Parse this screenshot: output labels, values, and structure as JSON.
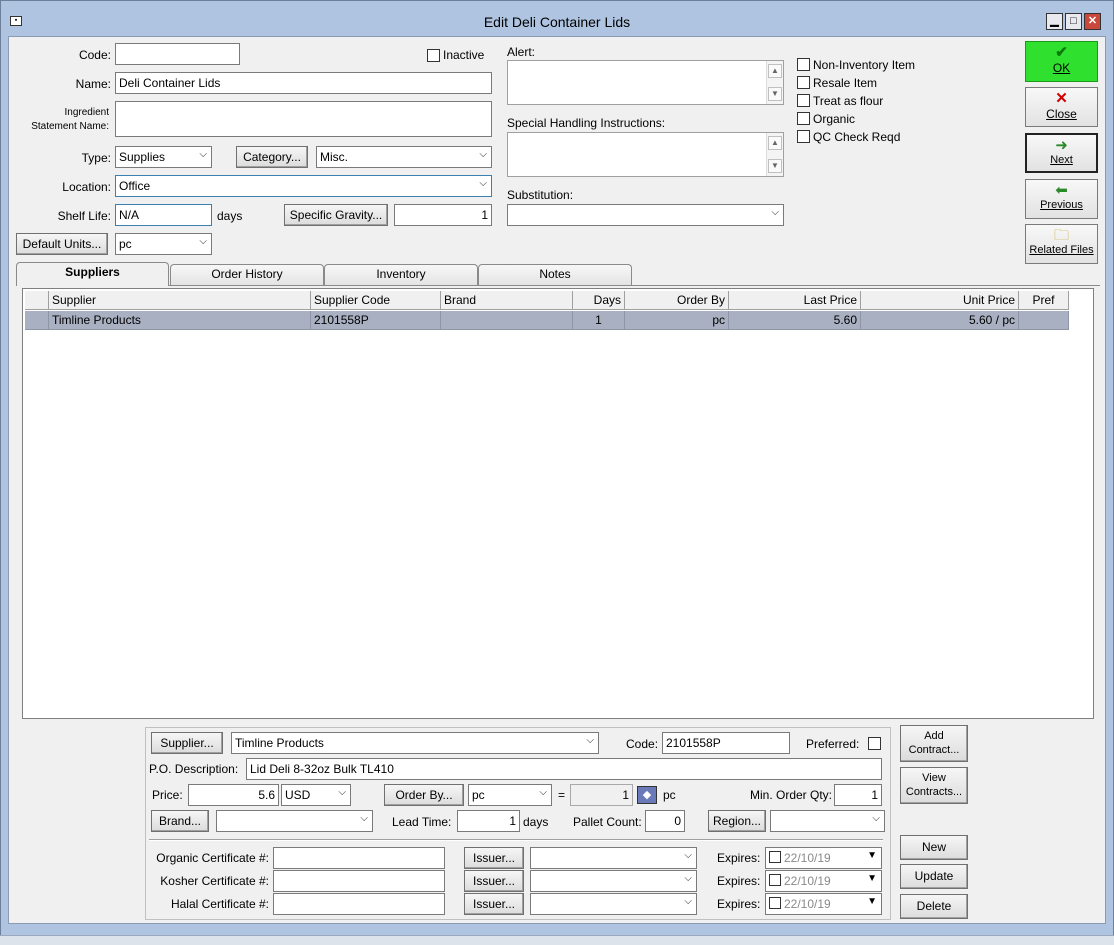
{
  "window": {
    "title": "Edit Deli Container Lids"
  },
  "form": {
    "code_label": "Code:",
    "code_value": "",
    "inactive_label": "Inactive",
    "name_label": "Name:",
    "name_value": "Deli Container Lids",
    "ingredient_label_1": "Ingredient",
    "ingredient_label_2": "Statement Name:",
    "ingredient_value": "",
    "type_label": "Type:",
    "type_value": "Supplies",
    "category_button": "Category...",
    "category_value": "Misc.",
    "location_label": "Location:",
    "location_value": "Office",
    "shelf_life_label": "Shelf Life:",
    "shelf_life_value": "N/A",
    "days_label": "days",
    "specific_gravity_button": "Specific Gravity...",
    "specific_gravity_value": "1",
    "default_units_button": "Default Units...",
    "default_units_value": "pc",
    "alert_label": "Alert:",
    "special_handling_label": "Special Handling Instructions:",
    "substitution_label": "Substitution:",
    "substitution_value": ""
  },
  "options": {
    "non_inventory": "Non-Inventory Item",
    "resale": "Resale Item",
    "treat_as_flour": "Treat as flour",
    "organic": "Organic",
    "qc_check": "QC Check Reqd"
  },
  "actions": {
    "ok": "OK",
    "close": "Close",
    "next": "Next",
    "previous": "Previous",
    "related_files": "Related Files"
  },
  "tabs": [
    "Suppliers",
    "Order History",
    "Inventory",
    "Notes"
  ],
  "grid": {
    "headers": [
      "Supplier",
      "Supplier Code",
      "Brand",
      "Days",
      "Order By",
      "Last Price",
      "Unit Price",
      "Pref"
    ],
    "rows": [
      {
        "supplier": "Timline Products",
        "code": "2101558P",
        "brand": "",
        "days": "1",
        "order_by": "pc",
        "last_price": "5.60",
        "unit_price": "5.60 / pc",
        "pref": ""
      }
    ]
  },
  "detail": {
    "supplier_button": "Supplier...",
    "supplier_value": "Timline Products",
    "code_label": "Code:",
    "code_value": "2101558P",
    "preferred_label": "Preferred:",
    "po_desc_label": "P.O. Description:",
    "po_desc_value": "Lid Deli 8-32oz Bulk TL410",
    "price_label": "Price:",
    "price_value": "5.6",
    "currency_value": "USD",
    "order_by_button": "Order By...",
    "order_by_value": "pc",
    "equals": "=",
    "qty_value": "1",
    "qty_unit": "pc",
    "min_order_label": "Min. Order Qty:",
    "min_order_value": "1",
    "brand_button": "Brand...",
    "brand_value": "",
    "lead_time_label": "Lead Time:",
    "lead_time_value": "1",
    "lead_days": "days",
    "pallet_label": "Pallet Count:",
    "pallet_value": "0",
    "region_button": "Region...",
    "region_value": "",
    "organic_cert_label": "Organic Certificate #:",
    "kosher_cert_label": "Kosher Certificate #:",
    "halal_cert_label": "Halal Certificate #:",
    "issuer_button": "Issuer...",
    "expires_label": "Expires:",
    "expires_value": "22/10/19"
  },
  "side_buttons": {
    "add_contract_1": "Add",
    "add_contract_2": "Contract...",
    "view_contracts_1": "View",
    "view_contracts_2": "Contracts...",
    "new": "New",
    "update": "Update",
    "delete": "Delete"
  }
}
